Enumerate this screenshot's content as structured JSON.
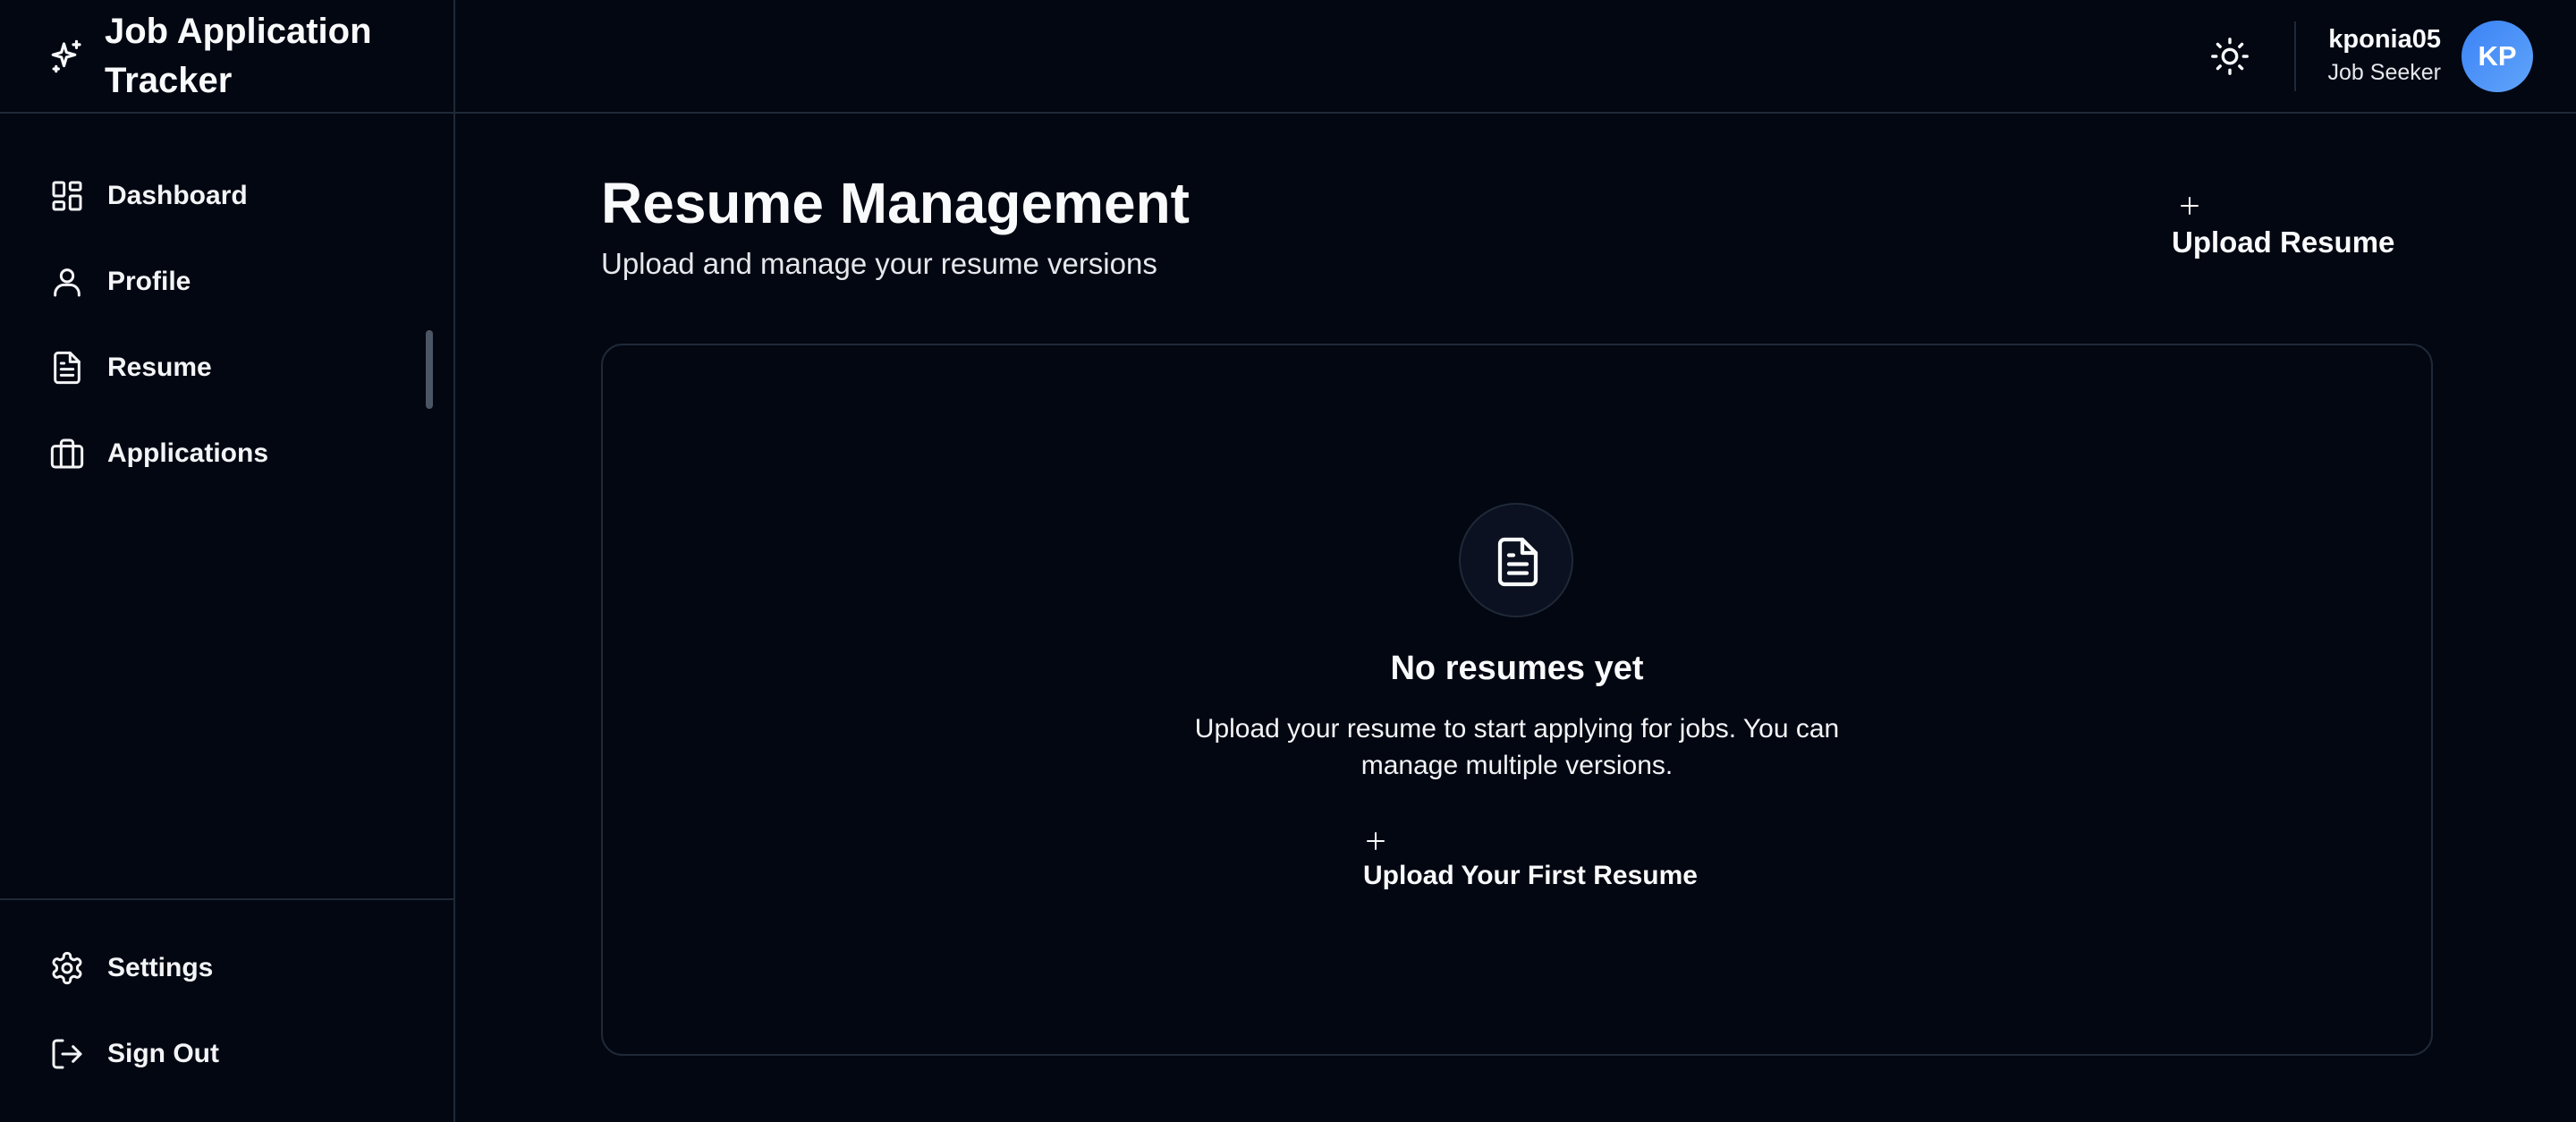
{
  "app": {
    "title": "Job Application Tracker",
    "brand_icon": "sparkles-icon"
  },
  "sidebar": {
    "items": [
      {
        "label": "Dashboard",
        "icon": "dashboard-icon"
      },
      {
        "label": "Profile",
        "icon": "user-icon"
      },
      {
        "label": "Resume",
        "icon": "file-text-icon",
        "active": true
      },
      {
        "label": "Applications",
        "icon": "briefcase-icon"
      }
    ],
    "footer_items": [
      {
        "label": "Settings",
        "icon": "gear-icon"
      },
      {
        "label": "Sign Out",
        "icon": "logout-icon"
      }
    ]
  },
  "header": {
    "theme_icon": "sun-icon",
    "user": {
      "name": "kponia05",
      "role": "Job Seeker",
      "initials": "KP"
    }
  },
  "main": {
    "title": "Resume Management",
    "subtitle": "Upload and manage your resume versions",
    "upload_button": "Upload Resume",
    "empty_state": {
      "icon": "file-text-icon",
      "title": "No resumes yet",
      "description": "Upload your resume to start applying for jobs. You can manage multiple versions.",
      "button": "Upload Your First Resume"
    }
  },
  "colors": {
    "background": "#030712",
    "border": "#1f2937",
    "text": "#f9fafb",
    "avatar_gradient_start": "#3b82f6",
    "avatar_gradient_end": "#60a5fa"
  }
}
